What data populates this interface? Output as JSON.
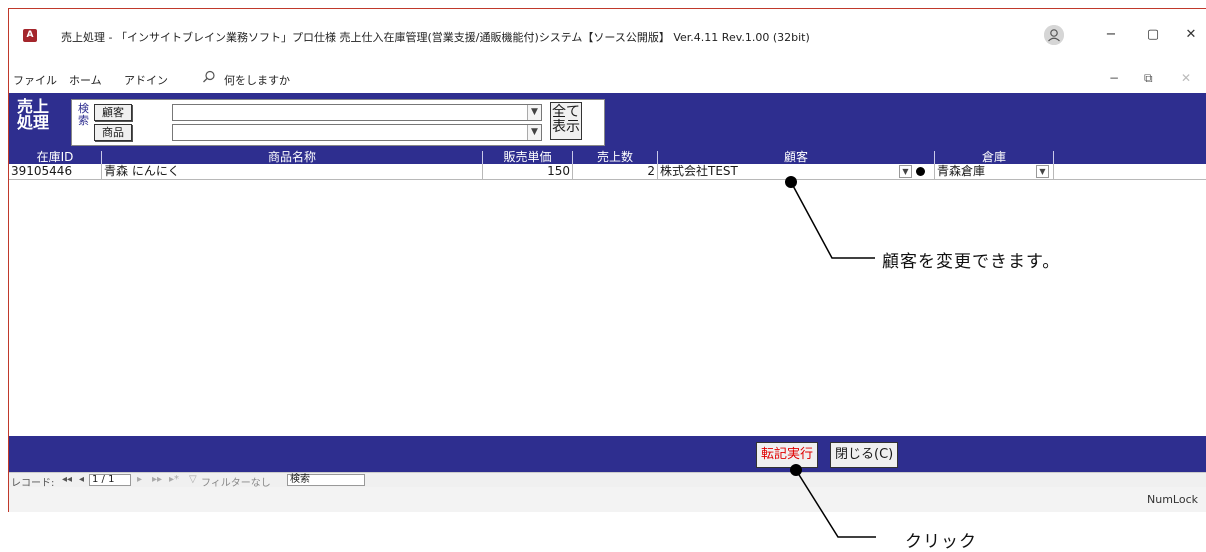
{
  "window": {
    "title": "売上処理 - 「インサイトブレイン業務ソフト」プロ仕様 売上仕入在庫管理(営業支援/通販機能付)システム【ソース公開版】 Ver.4.11 Rev.1.00 (32bit)",
    "app_icon_text": "A",
    "user_icon": "person-icon",
    "minimize": "−",
    "maximize": "▢",
    "close": "✕"
  },
  "menu": {
    "items": [
      "ファイル",
      "ホーム",
      "アドイン"
    ],
    "search_glyph": "⚲",
    "search_label": "何をしますか",
    "mdi_minimize": "−",
    "mdi_restore": "⧉",
    "mdi_close": "✕"
  },
  "header": {
    "form_title_line1": "売上",
    "form_title_line2": "処理",
    "search_label": "検索",
    "customer_button": "顧客",
    "product_button": "商品",
    "customer_combo_value": "",
    "product_combo_value": "",
    "show_all_line1": "全て",
    "show_all_line2": "表示"
  },
  "grid": {
    "columns": [
      "在庫ID",
      "商品名称",
      "販売単価",
      "売上数",
      "顧客",
      "倉庫"
    ],
    "rows": [
      {
        "stock_id": "39105446",
        "product_name": "青森 にんにく",
        "unit_price": "150",
        "quantity": "2",
        "customer": "株式会社TEST",
        "warehouse": "青森倉庫"
      }
    ]
  },
  "footer": {
    "post_button": "転記実行",
    "close_button": "閉じる(C)"
  },
  "navigation": {
    "record_label": "レコード:",
    "first": "◂◂",
    "prev": "◂",
    "record_position": "1 / 1",
    "next": "▸",
    "last": "▸▸",
    "new": "▸*",
    "filter_status": "フィルターなし",
    "search_box": "検索"
  },
  "status": {
    "numlock": "NumLock"
  },
  "annotations": {
    "customer_note": "顧客を変更できます。",
    "click_note": "クリック"
  },
  "colors": {
    "form_band": "#2e2e8f",
    "post_button_text": "#e00000",
    "window_border": "#c0392b"
  }
}
